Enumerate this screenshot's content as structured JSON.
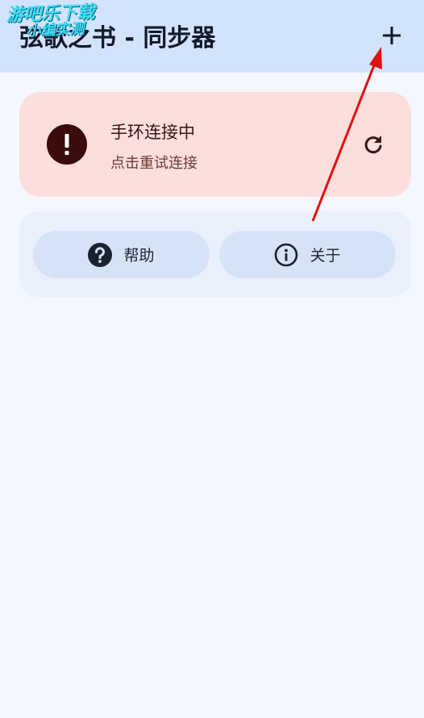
{
  "app_bar": {
    "title": "弦歌之书 - 同步器",
    "add_label": "+"
  },
  "watermark": {
    "line1": "游吧乐下载",
    "line2": "小编实测"
  },
  "status_card": {
    "title": "手环连接中",
    "subtitle": "点击重试连接",
    "icon": "error-icon",
    "action_icon": "refresh-icon"
  },
  "actions": {
    "help_label": "帮助",
    "help_icon": "help-circle-icon",
    "about_label": "关于",
    "about_icon": "info-icon"
  },
  "colors": {
    "app_bar_bg": "#d3e3fd",
    "page_bg": "#f4f7ff",
    "status_card_bg": "#fcdedb",
    "error_icon": "#3b0a0a",
    "pill_bg": "#d6e3f7",
    "annotation_arrow": "#e01010"
  }
}
